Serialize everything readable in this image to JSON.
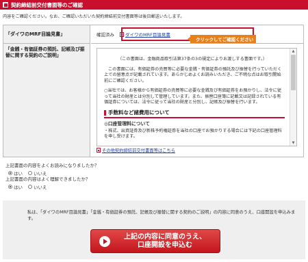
{
  "header": {
    "title": "契約締結前交付書面等のご確認"
  },
  "intro": "内容をご確認ください。なお、ご確認いただいた契約締結前交付書面等は後日郵送いたします。",
  "doc_table": {
    "left_title": "「ダイワのMRF目論見書」",
    "left_subtitle": "「金銭・有価証券の預託、記帳及び振替に関する契約のご説明」",
    "confirmed_label": "確認済み",
    "doc_link": "ダイワのMRF目論見書",
    "callout": "クリックしてご確認ください",
    "scroll": {
      "para1": "（この書面は、金融商品取引法第37条の3の規定によりお渡しする書面です。）",
      "para2": "この書面には、有価証券の売買等に必要な金銭・有価証券の預託及び振替を行っていただく上での留意点が記載されています。あらかじめよくお読みいただき、ご不明な点はお取引開始前にご確認ください。",
      "para3": "○当社では、お客様から有価証券の売買等に必要な金銭及び有価証券をお預かりし、法令に従って当社の財産とは分別して管理しています。また、振替口座簿に記載又は記録されている有価証券については、法令に従って当社の財産と分別し、記帳及び振替を行います。",
      "section": "手数料など諸費用について",
      "sub": "◎口座管理料について",
      "line": "・株式、出資証券及び新株予約権証券を当社の口座でお預かりする場合には下記の口座管理料を申し受けます。"
    },
    "other_link": "その他契約締結前交付書面等はこちら"
  },
  "questions": [
    {
      "label": "上記書面の内容をよくお読みになりましたか？",
      "yes": "はい",
      "no": "いいえ",
      "selected": "yes"
    },
    {
      "label": "上記書面の内容はよく理解できましたか？",
      "yes": "はい",
      "no": "いいえ",
      "selected": "yes"
    }
  ],
  "agree": {
    "text": "私は、「ダイワのMRF目論見書」「金銭・有価証券の預託、記帳及び振替に関する契約のご説明」の内容に同意のうえ、口座開設を申込みます。",
    "button_line1": "上記の内容に同意のうえ、",
    "button_line2": "口座開設を申込む"
  },
  "colors": {
    "brand": "#c8102e",
    "callout": "#e8801a",
    "link": "#1a3fa6"
  }
}
